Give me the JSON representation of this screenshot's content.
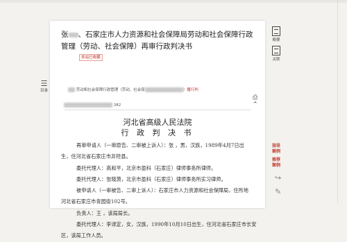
{
  "document": {
    "title_prefix": "张",
    "title_rest": "、石家庄市人力资源和社会保障局劳动和社会保障行政管理（劳动、社会保障）再审行政判决书",
    "tag": "本站已收藏",
    "meta_line": "劳动和社会保障行政管理（劳动、社会保",
    "meta_red": "）履行判",
    "meta_count": "382",
    "court_name": "河北省高级人民法院",
    "doc_type": "行 政 判 决 书",
    "paragraphs": [
      "再审申请人（一审原告、二审被上诉人）：张  ，男，汉族，1989年4月7日出",
      "生，住河北省石家庄市井陉县。",
      "委托代理人：高和平，北京市盈科（石家庄）律师事务所律师。",
      "委托代理人：张晓萧，北京市盈科（石家庄）律师事务所实习律师。",
      "被申请人（一审被告、二审上诉人）：石家庄市人力资源和社会保障局，住所地",
      "河北省石家庄市青园街102号。",
      "负责人：王  ，该局局长。",
      "委托代理人：李译定，女，汉族，1990年10月10日出生，住河北省石家庄市长安",
      "区，该局工作人员。"
    ]
  },
  "toc_label": "目录",
  "side": {
    "overview": "概要",
    "related": "关联",
    "links": [
      "指导",
      "案例",
      "推荐",
      "案例"
    ]
  },
  "tools": {
    "print": "⎙",
    "up": "⌃"
  }
}
